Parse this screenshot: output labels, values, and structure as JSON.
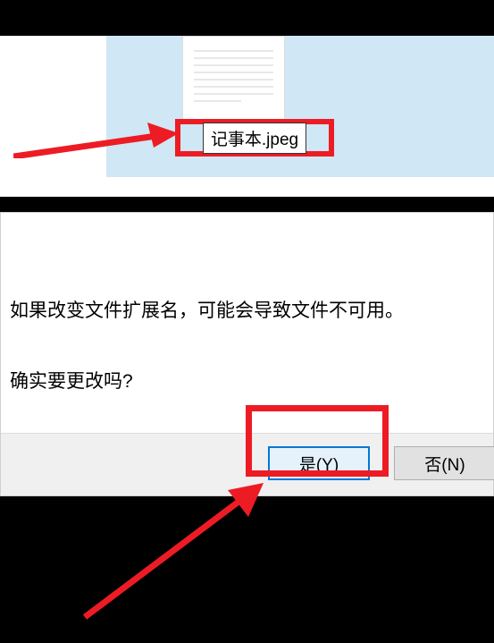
{
  "file": {
    "filename": "记事本.jpeg"
  },
  "dialog": {
    "warning": "如果改变文件扩展名，可能会导致文件不可用。",
    "confirm": "确实要更改吗?",
    "yes_label": "是(Y)",
    "no_label": "否(N)"
  },
  "annotations": {
    "highlight_color": "#ed1c24"
  }
}
